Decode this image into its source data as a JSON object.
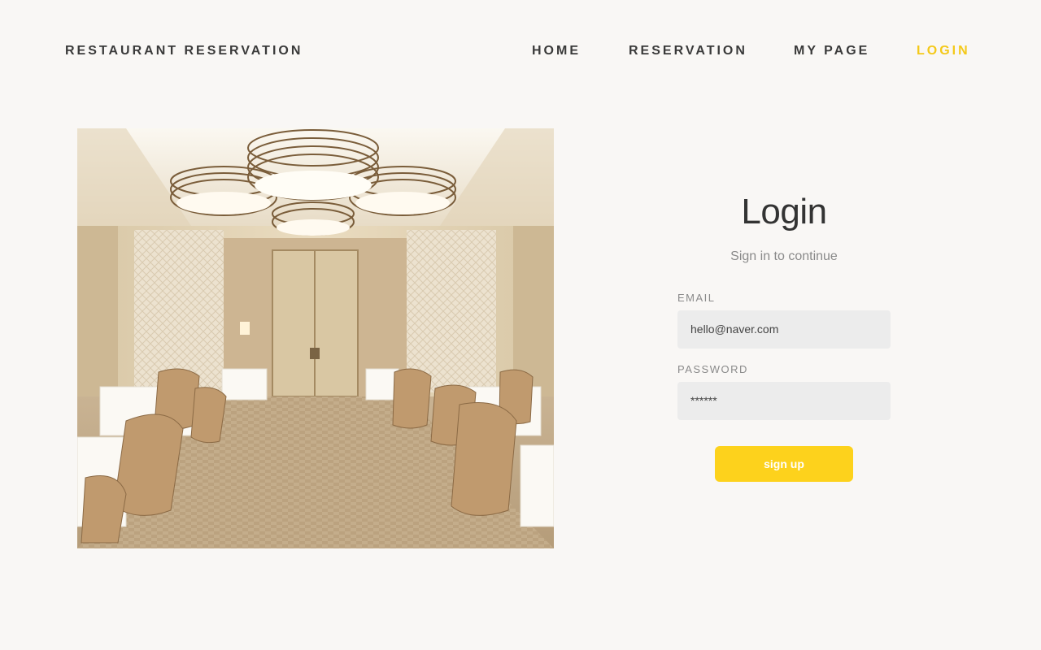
{
  "header": {
    "brand": "RESTAURANT RESERVATION",
    "nav": {
      "home": "HOME",
      "reservation": "RESERVATION",
      "my_page": "MY PAGE",
      "login": "LOGIN"
    },
    "active_color": "#f4c91a"
  },
  "login": {
    "title": "Login",
    "subtitle": "Sign in to continue",
    "email_label": "EMAIL",
    "email_value": "hello@naver.com",
    "password_label": "PASSWORD",
    "password_value": "******",
    "submit_label": "sign up",
    "button_color": "#fdd21c"
  }
}
